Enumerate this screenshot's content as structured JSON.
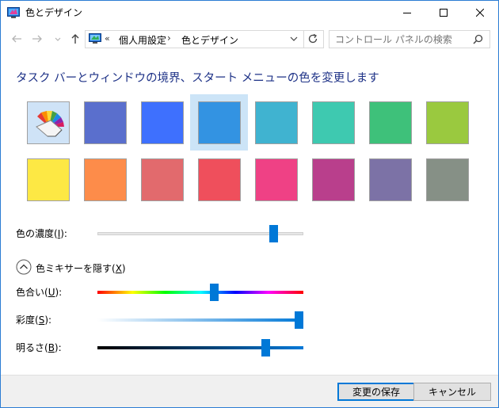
{
  "window": {
    "title": "色とデザイン",
    "accent_color": "#0078d7"
  },
  "address_bar": {
    "overflow_chevron": "«",
    "crumbs": [
      "個人用設定",
      "色とデザイン"
    ],
    "separator": "›"
  },
  "search": {
    "placeholder": "コントロール パネルの検索"
  },
  "page": {
    "heading": "タスク バーとウィンドウの境界、スタート メニューの色を変更します"
  },
  "swatches": {
    "selected_index": 3,
    "row1": [
      "auto",
      "#5a6fcd",
      "#3e70fe",
      "#3393e2",
      "#40b3d0",
      "#3ec9b0",
      "#3ec17a",
      "#9ac93f"
    ],
    "row2": [
      "#fde844",
      "#fd8c4a",
      "#e26a6d",
      "#ef4f5c",
      "#ef4185",
      "#b93f8c",
      "#7c72a6",
      "#869086"
    ]
  },
  "intensity": {
    "label_prefix": "色の濃度(",
    "accesskey": "I",
    "label_suffix": "):",
    "value": 0.87
  },
  "mixer": {
    "toggle_label_prefix": "色ミキサーを隠す(",
    "accesskey": "X",
    "toggle_label_suffix": ")"
  },
  "hue": {
    "label_prefix": "色合い(",
    "accesskey": "U",
    "label_suffix": "):",
    "value": 0.57
  },
  "saturation": {
    "label_prefix": "彩度(",
    "accesskey": "S",
    "label_suffix": "):",
    "value": 1.0
  },
  "brightness": {
    "label_prefix": "明るさ(",
    "accesskey": "B",
    "label_suffix": "):",
    "value": 0.83
  },
  "buttons": {
    "save": "変更の保存",
    "cancel": "キャンセル"
  }
}
